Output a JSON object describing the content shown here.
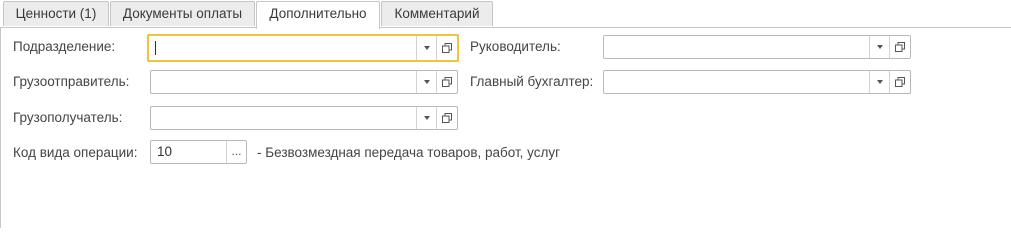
{
  "tabs": [
    {
      "label": "Ценности (1)",
      "active": false
    },
    {
      "label": "Документы оплаты",
      "active": false
    },
    {
      "label": "Дополнительно",
      "active": true
    },
    {
      "label": "Комментарий",
      "active": false
    }
  ],
  "form": {
    "subdivision_label": "Подразделение:",
    "subdivision_value": "",
    "shipper_label": "Грузоотправитель:",
    "shipper_value": "",
    "consignee_label": "Грузополучатель:",
    "consignee_value": "",
    "operation_code_label": "Код вида операции:",
    "operation_code_value": "10",
    "operation_code_dots": "...",
    "operation_code_description": "- Безвозмездная передача товаров, работ, услуг",
    "head_label": "Руководитель:",
    "head_value": "",
    "chief_accountant_label": "Главный бухгалтер:",
    "chief_accountant_value": ""
  },
  "icons": {
    "dropdown": "chevron-down-icon",
    "open": "open-window-icon"
  },
  "colors": {
    "focus_border": "#f0c43a",
    "tab_inactive_bg": "#ececec",
    "border": "#b9b9b9"
  }
}
